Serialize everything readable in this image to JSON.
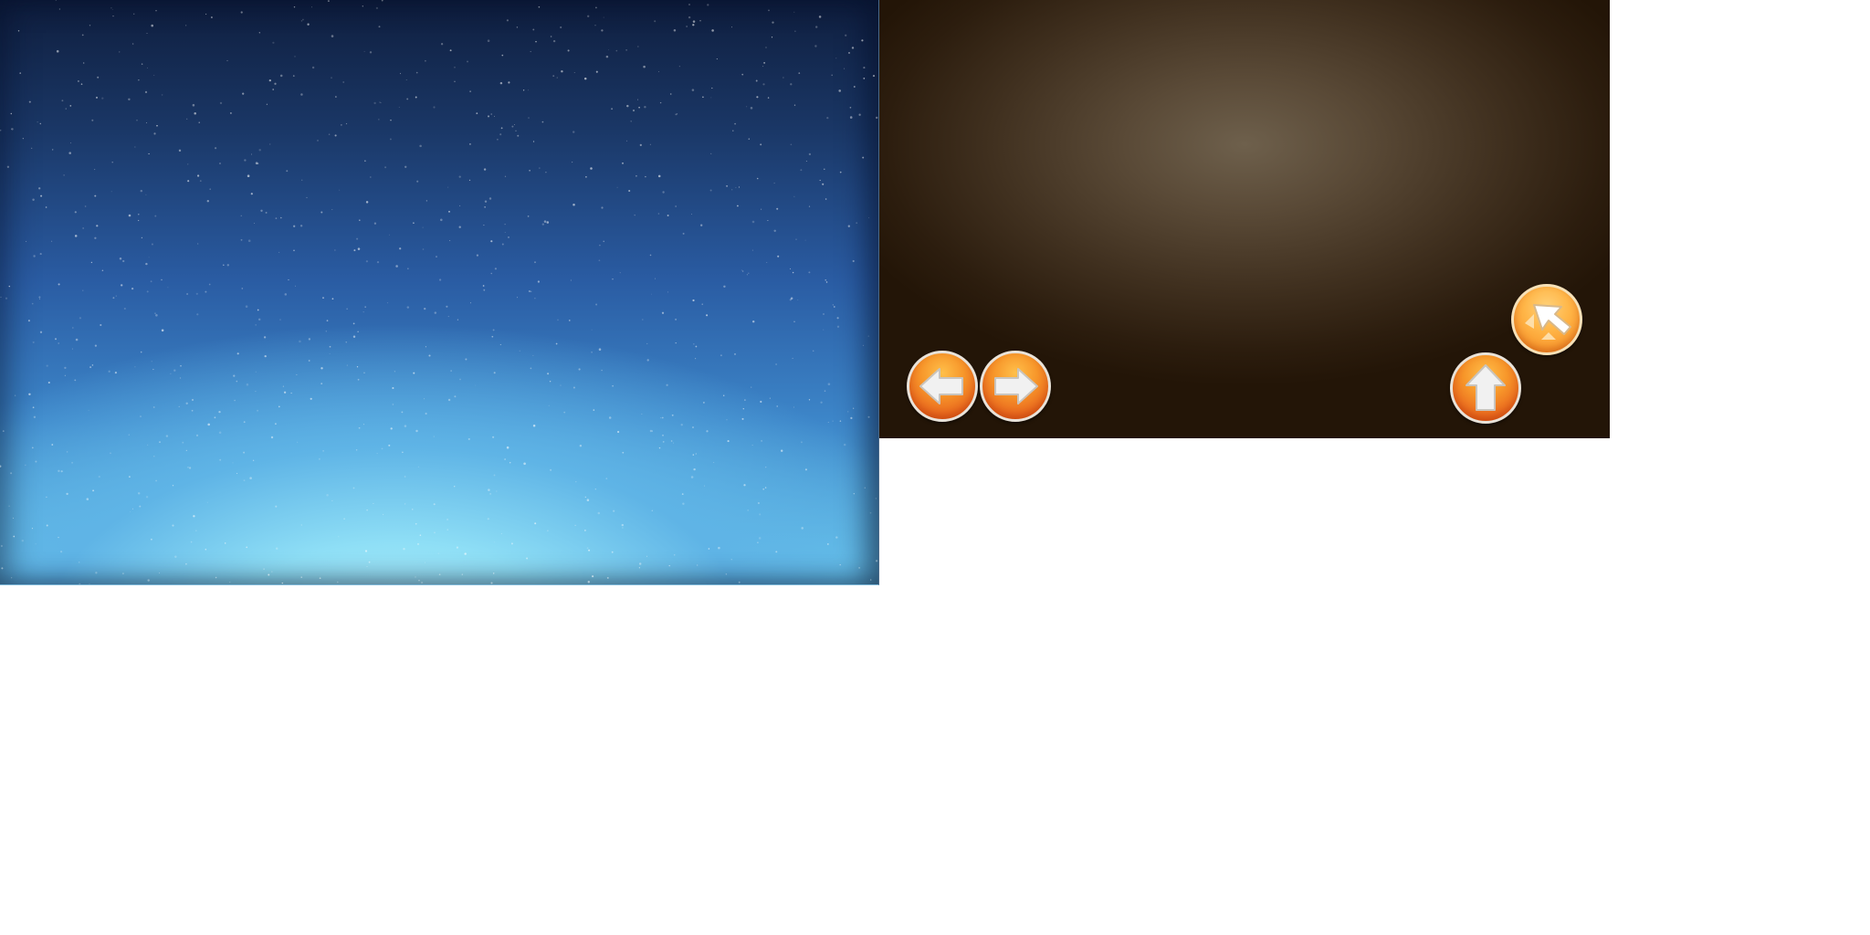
{
  "scene": {
    "sky_panel": {
      "colors": {
        "top": "#0f1e3e",
        "middle": "#2a5ca3",
        "bottom": "#b2effc"
      }
    },
    "game_panel": {
      "colors": {
        "center": "#6e604c",
        "edge": "#231507"
      },
      "controls": {
        "prev": {
          "icon": "arrow-left-icon",
          "color": "#ea6a1e"
        },
        "next": {
          "icon": "arrow-right-icon",
          "color": "#ea6a1e"
        },
        "up": {
          "icon": "arrow-up-icon",
          "color": "#ea6a1e"
        },
        "cursor": {
          "icon": "cursor-arrow-icon",
          "color": "#ffb648"
        }
      }
    }
  }
}
